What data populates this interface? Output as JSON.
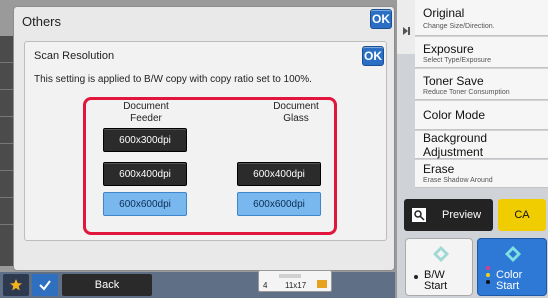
{
  "others": {
    "title": "Others",
    "ok_label": "OK"
  },
  "dialog": {
    "title": "Scan Resolution",
    "ok_label": "OK",
    "description": "This setting is applied to B/W copy with copy ratio set to 100%.",
    "columns": {
      "feeder": {
        "header_line1": "Document",
        "header_line2": "Feeder",
        "options": [
          "600x300dpi",
          "600x400dpi",
          "600x600dpi"
        ],
        "selected": "600x600dpi"
      },
      "glass": {
        "header_line1": "Document",
        "header_line2": "Glass",
        "options": [
          "600x400dpi",
          "600x600dpi"
        ],
        "selected": "600x600dpi"
      }
    }
  },
  "bottom": {
    "back_label": "Back",
    "paper_tray": "4",
    "paper_size": "11x17"
  },
  "right_menu": {
    "original": {
      "label": "Original",
      "sub": "Change Size/Direction."
    },
    "exposure": {
      "label": "Exposure",
      "sub": "Select Type/Exposure"
    },
    "toner_save": {
      "label": "Toner Save",
      "sub": "Reduce Toner Consumption"
    },
    "color_mode": {
      "label": "Color Mode"
    },
    "background_adjustment": {
      "label": "Background Adjustment"
    },
    "erase": {
      "label": "Erase",
      "sub": "Erase Shadow Around"
    }
  },
  "actions": {
    "preview_label": "Preview",
    "ca_label": "CA",
    "bw_start_line1": "B/W",
    "bw_start_line2": "Start",
    "color_start_line1": "Color",
    "color_start_line2": "Start"
  },
  "colors": {
    "accent_blue": "#2a6fc3",
    "highlight_red": "#e2163c",
    "selected_blue": "#78b8ef",
    "ca_yellow": "#f0cd00"
  }
}
